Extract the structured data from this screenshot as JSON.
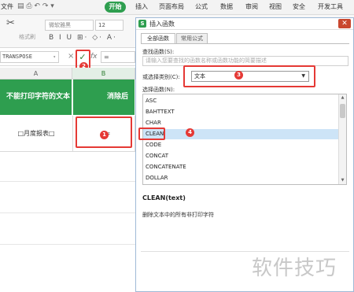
{
  "menubar": {
    "file": "文件",
    "start": "开始",
    "insert": "插入",
    "page_layout": "页面布局",
    "formula": "公式",
    "data": "数据",
    "review": "审阅",
    "view": "视图",
    "security": "安全",
    "developer": "开发工具"
  },
  "ribbon": {
    "format_painter": "格式刷",
    "font_name": "微软雅黑",
    "font_size": "12",
    "format_buttons": "B I U ⊞· ◇· A·"
  },
  "formula_bar": {
    "name_box": "TRANSPOSE",
    "x_icon": "×",
    "check_icon": "✓",
    "fx_label": "fx",
    "formula": "="
  },
  "sheet": {
    "col_a": "A",
    "col_b": "B",
    "header_a": "不能打印字符的文本",
    "header_b": "消除后",
    "row_a": "□月度报表□",
    "row_b": "="
  },
  "badges": {
    "one": "1",
    "two": "2",
    "three": "3",
    "four": "4"
  },
  "dialog": {
    "title": "插入函数",
    "logo": "S",
    "close": "✕",
    "tab_all": "全部函数",
    "tab_common": "常用公式",
    "search_label": "查找函数(S):",
    "search_placeholder": "请输入您要查找的函数名称或函数功能的简要描述",
    "category_label": "或选择类别(C):",
    "category_value": "文本",
    "select_label": "选择函数(N):",
    "functions": [
      "ASC",
      "BAHTTEXT",
      "CHAR",
      "CLEAN",
      "CODE",
      "CONCAT",
      "CONCATENATE",
      "DOLLAR"
    ],
    "selected_function": "CLEAN",
    "signature": "CLEAN(text)",
    "description": "删除文本中的所有非打印字符"
  },
  "watermark": "软件技巧",
  "colors": {
    "brand_green": "#2e9e4f",
    "annotation_red": "#e53935",
    "selection_blue": "#cde4f7"
  }
}
